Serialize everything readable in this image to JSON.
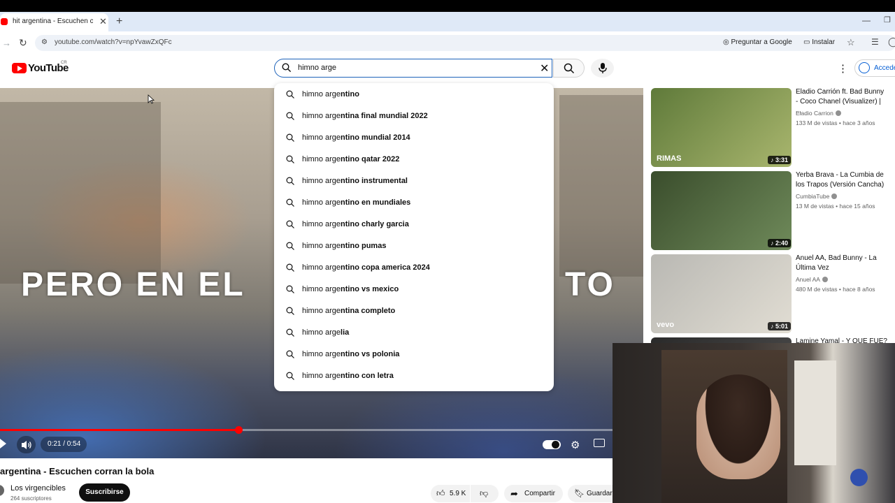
{
  "browser": {
    "tab_title": "hit argentina - Escuchen corr",
    "url": "youtube.com/watch?v=npYvawZxQFc",
    "ask_google_label": "Preguntar a Google",
    "install_label": "Instalar"
  },
  "youtube": {
    "logo_text": "YouTube",
    "country_code": "CR",
    "search_value": "himno arge",
    "signin_label": "Acceder"
  },
  "suggestions": {
    "query_prefix": "himno arge",
    "items": [
      {
        "match": "himno arge",
        "rest": "ntino"
      },
      {
        "match": "himno arge",
        "rest": "ntina final mundial 2022"
      },
      {
        "match": "himno arge",
        "rest": "ntino mundial 2014"
      },
      {
        "match": "himno arge",
        "rest": "ntino qatar 2022"
      },
      {
        "match": "himno arge",
        "rest": "ntino instrumental"
      },
      {
        "match": "himno arge",
        "rest": "ntino en mundiales"
      },
      {
        "match": "himno arge",
        "rest": "ntino charly garcia"
      },
      {
        "match": "himno arge",
        "rest": "ntino pumas"
      },
      {
        "match": "himno arge",
        "rest": "ntino copa america 2024"
      },
      {
        "match": "himno arge",
        "rest": "ntino vs mexico"
      },
      {
        "match": "himno arge",
        "rest": "ntina completo"
      },
      {
        "match": "himno arge",
        "rest": "lia"
      },
      {
        "match": "himno arge",
        "rest": "ntino vs polonia"
      },
      {
        "match": "himno arge",
        "rest": "ntino con letra"
      }
    ]
  },
  "player": {
    "caption_left": "PERO EN EL",
    "caption_right": "TO",
    "time": "0:21 / 0:54",
    "progress": 0.389
  },
  "video": {
    "title": "argentina - Escuchen corran la bola",
    "channel": "Los virgencibles",
    "subscribers": "264 suscriptores",
    "subscribe_label": "Suscribirse",
    "likes": "5.9 K",
    "share_label": "Compartir",
    "save_label": "Guardar"
  },
  "recommended": [
    {
      "title": "Eladio Carrión ft. Bad Bunny - Coco Chanel (Visualizer) | ...",
      "channel": "Eladio Carrion",
      "meta": "133 M de vistas • hace 3 años",
      "duration": "3:31",
      "thumb_label": "RIMAS",
      "colors": [
        "#5f7a3a",
        "#a9b66e"
      ]
    },
    {
      "title": "Yerba Brava - La Cumbia de los Trapos (Versión Cancha)",
      "channel": "CumbiaTube",
      "meta": "13 M de vistas • hace 15 años",
      "duration": "2:40",
      "thumb_label": "",
      "colors": [
        "#3a4d2c",
        "#6f8a5a"
      ]
    },
    {
      "title": "Anuel AA, Bad Bunny - La Última Vez",
      "channel": "Anuel AA",
      "meta": "480 M de vistas • hace 8 años",
      "duration": "5:01",
      "thumb_label": "vevo",
      "colors": [
        "#b9b8b3",
        "#e1ddd3"
      ]
    },
    {
      "title": "Lamine Yamal - Y QUE FUE?",
      "channel": "",
      "meta": "",
      "duration": "",
      "thumb_label": "",
      "colors": [
        "#2a2a2a",
        "#444"
      ]
    }
  ]
}
